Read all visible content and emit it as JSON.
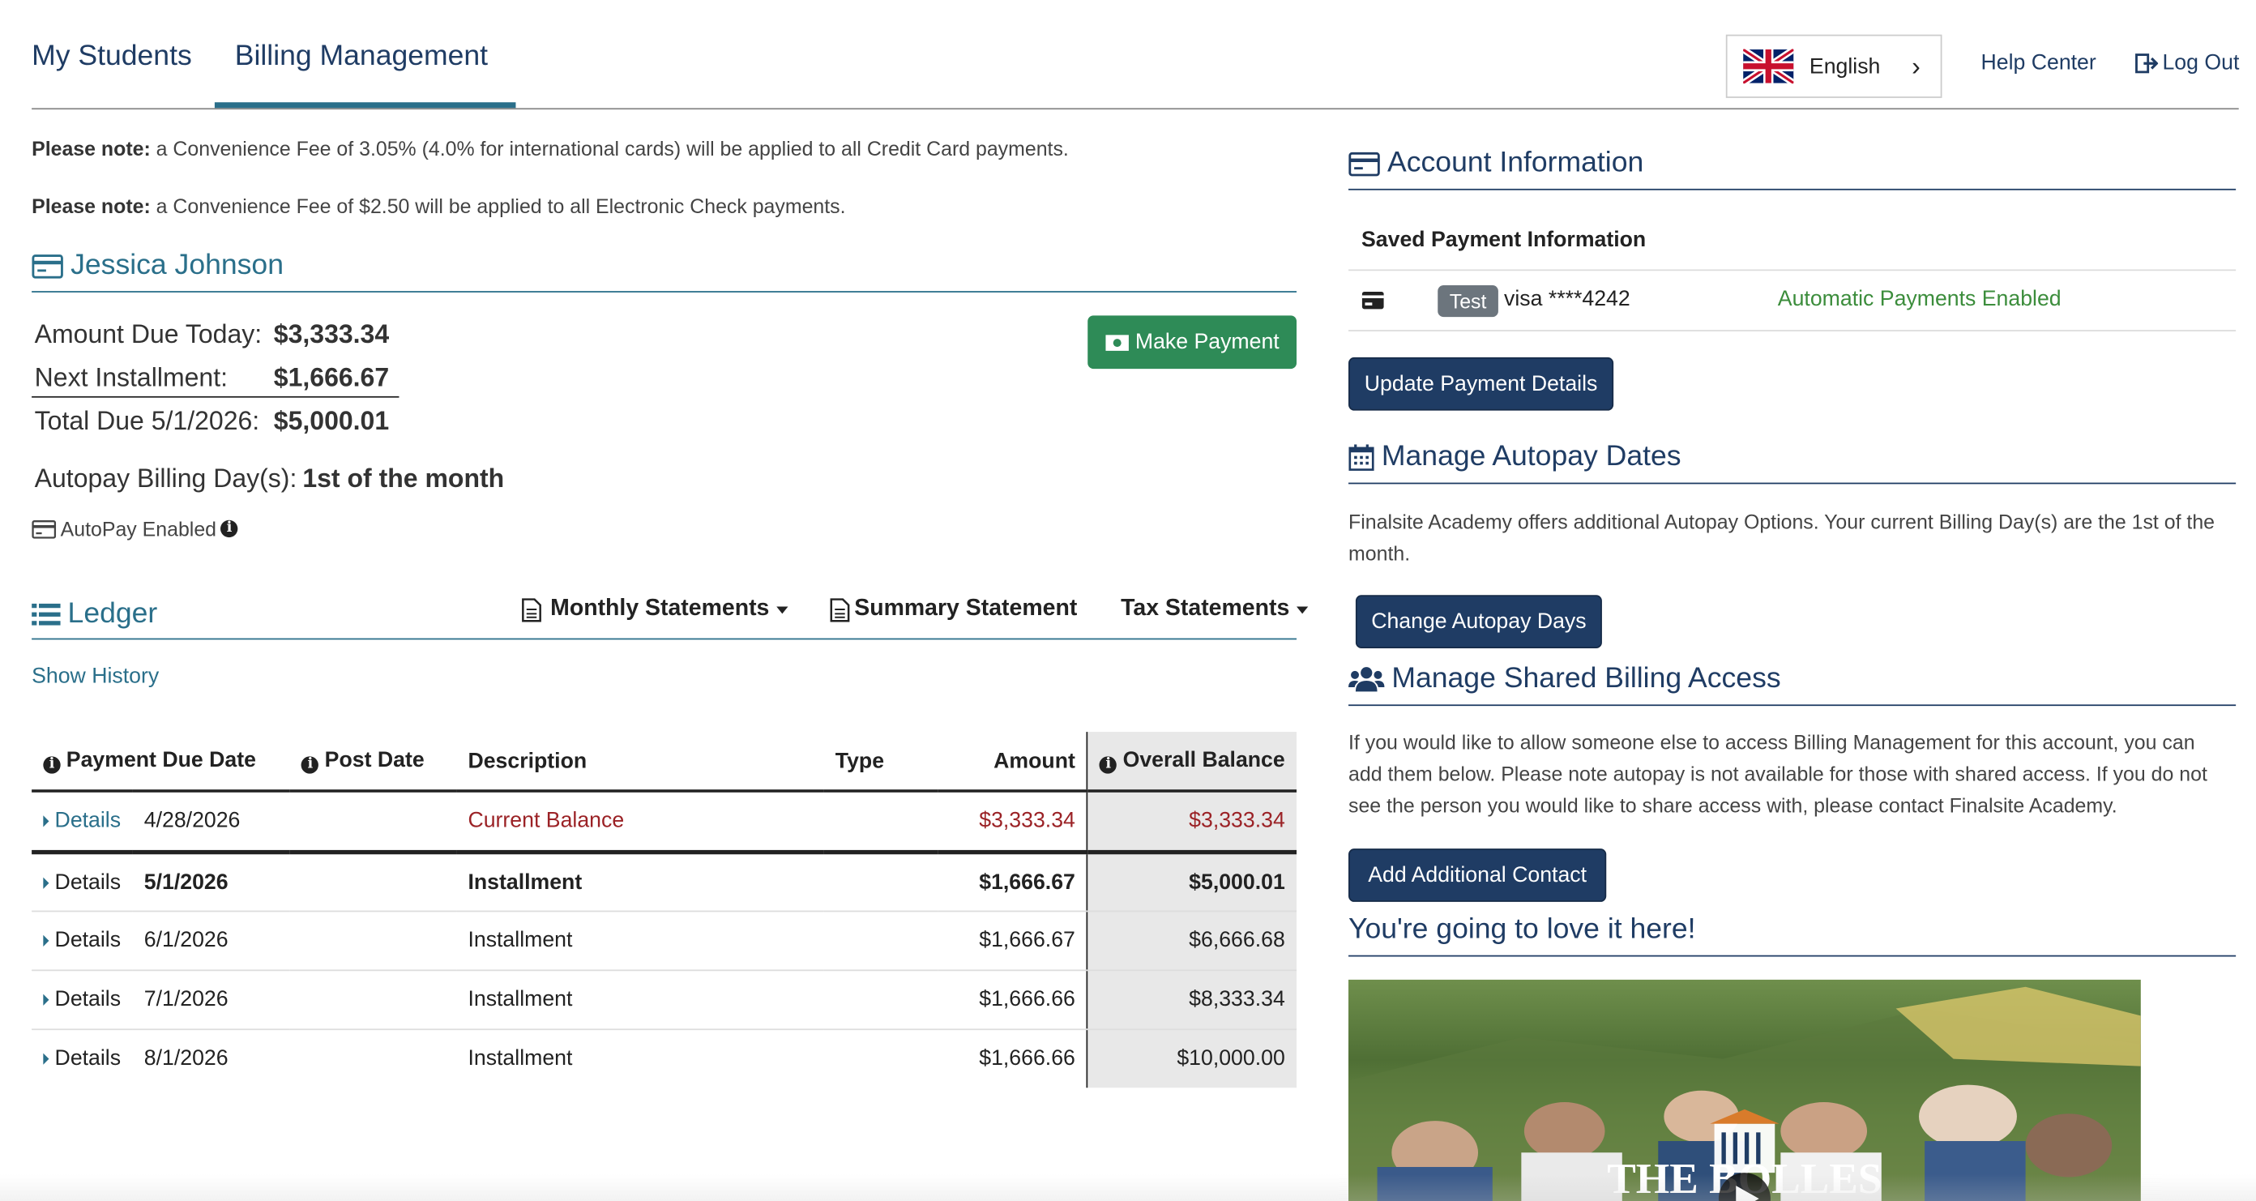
{
  "nav": {
    "tabs": [
      "My Students",
      "Billing Management"
    ],
    "active_tab": "Billing Management",
    "language": "English",
    "help": "Help Center",
    "logout": "Log Out"
  },
  "notes": {
    "prefix": "Please note:",
    "credit": "a Convenience Fee of 3.05% (4.0% for international cards) will be applied to all Credit Card payments.",
    "check": "a Convenience Fee of $2.50 will be applied to all Electronic Check payments."
  },
  "student": {
    "name": "Jessica Johnson",
    "rows": [
      {
        "label": "Amount Due Today:",
        "value": "$3,333.34"
      },
      {
        "label": "Next Installment:",
        "value": "$1,666.67"
      },
      {
        "label": "Total Due 5/1/2026:",
        "value": "$5,000.01"
      }
    ],
    "make_payment": "Make Payment",
    "autopay_label": "Autopay Billing Day(s):",
    "autopay_value": "1st of the month",
    "autopay_enabled": "AutoPay Enabled"
  },
  "ledger": {
    "title": "Ledger",
    "monthly": "Monthly Statements",
    "summary": "Summary Statement",
    "tax": "Tax Statements",
    "show_history": "Show History",
    "columns": [
      "Payment Due Date",
      "Post Date",
      "Description",
      "Type",
      "Amount",
      "Overall Balance"
    ],
    "rows": [
      {
        "details": "Details",
        "due": "4/28/2026",
        "post": "",
        "desc": "Current Balance",
        "type": "",
        "amount": "$3,333.34",
        "balance": "$3,333.34"
      },
      {
        "details": "Details",
        "due": "5/1/2026",
        "post": "",
        "desc": "Installment",
        "type": "",
        "amount": "$1,666.67",
        "balance": "$5,000.01"
      },
      {
        "details": "Details",
        "due": "6/1/2026",
        "post": "",
        "desc": "Installment",
        "type": "",
        "amount": "$1,666.67",
        "balance": "$6,666.68"
      },
      {
        "details": "Details",
        "due": "7/1/2026",
        "post": "",
        "desc": "Installment",
        "type": "",
        "amount": "$1,666.66",
        "balance": "$8,333.34"
      },
      {
        "details": "Details",
        "due": "8/1/2026",
        "post": "",
        "desc": "Installment",
        "type": "",
        "amount": "$1,666.66",
        "balance": "$10,000.00"
      }
    ]
  },
  "account": {
    "title": "Account Information",
    "saved_header": "Saved Payment Information",
    "badge": "Test",
    "card": "visa ****4242",
    "auto_status": "Automatic Payments Enabled",
    "update_btn": "Update Payment Details"
  },
  "autopay_dates": {
    "title": "Manage Autopay Dates",
    "text": "Finalsite Academy offers additional Autopay Options. Your current Billing Day(s) are the 1st of the month.",
    "btn": "Change Autopay Days"
  },
  "shared": {
    "title": "Manage Shared Billing Access",
    "text": "If you would like to allow someone else to access Billing Management for this account, you can add them below. Please note autopay is not available for those with shared access. If you do not see the person you would like to share access with, please contact Finalsite Academy.",
    "btn": "Add Additional Contact"
  },
  "promo": {
    "title": "You're going to love it here!",
    "video_logo": "THE BOLLES"
  }
}
